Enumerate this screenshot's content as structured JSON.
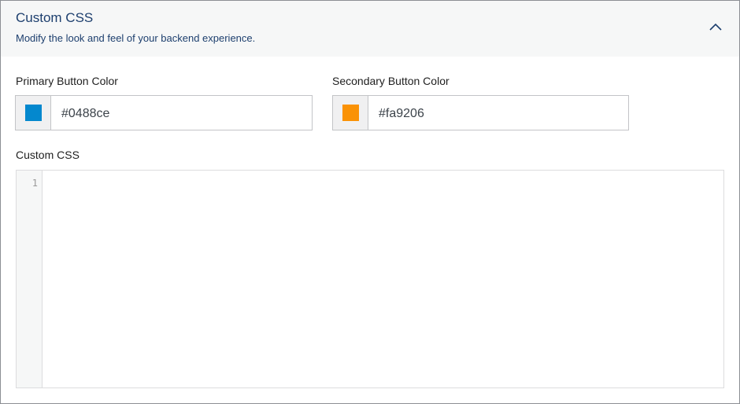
{
  "panel": {
    "title": "Custom CSS",
    "subtitle": "Modify the look and feel of your backend experience.",
    "toggle_icon": "chevron-up-icon"
  },
  "primary_color": {
    "label": "Primary Button Color",
    "value": "#0488ce",
    "swatch": "#0488ce"
  },
  "secondary_color": {
    "label": "Secondary Button Color",
    "value": "#fa9206",
    "swatch": "#fa9206"
  },
  "custom_css": {
    "label": "Custom CSS",
    "line_numbers": [
      "1"
    ],
    "content": ""
  }
}
